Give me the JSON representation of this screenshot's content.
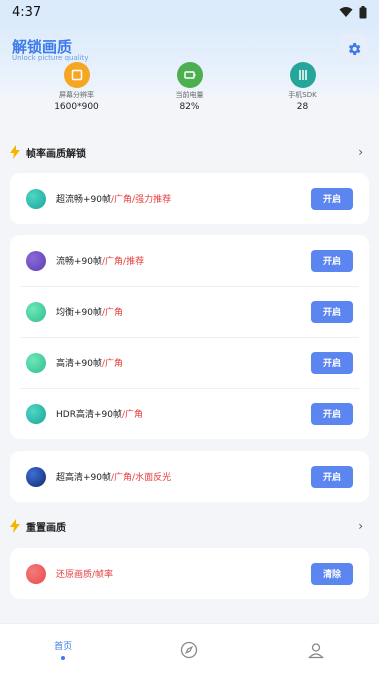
{
  "status_bar": {
    "time": "4:37"
  },
  "header": {
    "title": "解锁画质",
    "subtitle": "Unlock picture quality"
  },
  "stats": [
    {
      "icon": "resolution-icon",
      "label": "屏幕分辨率",
      "value": "1600*900",
      "color": "#f5a623"
    },
    {
      "icon": "battery-icon",
      "label": "当前电量",
      "value": "82%",
      "color": "#4caf50"
    },
    {
      "icon": "sdk-icon",
      "label": "手机SDK",
      "value": "28",
      "color": "#26a69a"
    }
  ],
  "section_unlock": {
    "title": "帧率画质解锁"
  },
  "section_reset": {
    "title": "重置画质"
  },
  "options": [
    {
      "name": "超流畅+90帧",
      "tags": "/广角/强力推荐",
      "button": "开启",
      "color": "#1aa59b"
    },
    {
      "name": "流畅+90帧",
      "tags": "/广角/推荐",
      "button": "开启",
      "color": "#5e3fb4"
    },
    {
      "name": "均衡+90帧",
      "tags": "/广角",
      "button": "开启",
      "color": "#2ebf8f"
    },
    {
      "name": "高清+90帧",
      "tags": "/广角",
      "button": "开启",
      "color": "#2ebf8f"
    },
    {
      "name": "HDR高清+90帧",
      "tags": "/广角",
      "button": "开启",
      "color": "#1aa59b"
    },
    {
      "name": "超高清+90帧",
      "tags": "/广角/水面反光",
      "button": "开启",
      "color": "#1b3c8a"
    }
  ],
  "reset": {
    "label": "还原画质/帧率",
    "button": "清除",
    "color": "#e94b4b"
  },
  "nav": {
    "home_label": "首页"
  },
  "colors": {
    "accent": "#5b86f0",
    "tag_red": "#e53d3d"
  }
}
